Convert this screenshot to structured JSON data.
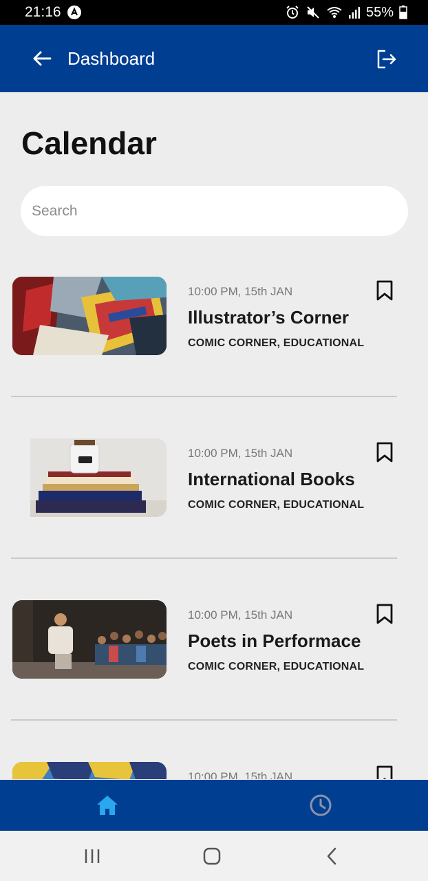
{
  "status_bar": {
    "time": "21:16",
    "battery": "55%"
  },
  "header": {
    "title": "Dashboard"
  },
  "page": {
    "title": "Calendar"
  },
  "search": {
    "placeholder": "Search",
    "value": ""
  },
  "events": [
    {
      "time": "10:00 PM, 15th JAN",
      "name": "Illustrator’s Corner",
      "tags": "COMIC CORNER, EDUCATIONAL"
    },
    {
      "time": "10:00 PM, 15th JAN",
      "name": "International Books",
      "tags": "COMIC CORNER, EDUCATIONAL"
    },
    {
      "time": "10:00 PM, 15th JAN",
      "name": "Poets in Performace",
      "tags": "COMIC CORNER, EDUCATIONAL"
    },
    {
      "time": "10:00 PM, 15th JAN",
      "name": "",
      "tags": ""
    }
  ],
  "bottom_nav": {
    "items": [
      {
        "icon": "home-icon",
        "active": true
      },
      {
        "icon": "clock-icon",
        "active": false
      }
    ],
    "active_color": "#29a8f0",
    "inactive_color": "#8a93a8"
  },
  "colors": {
    "primary": "#003e92",
    "background": "#ededed"
  }
}
